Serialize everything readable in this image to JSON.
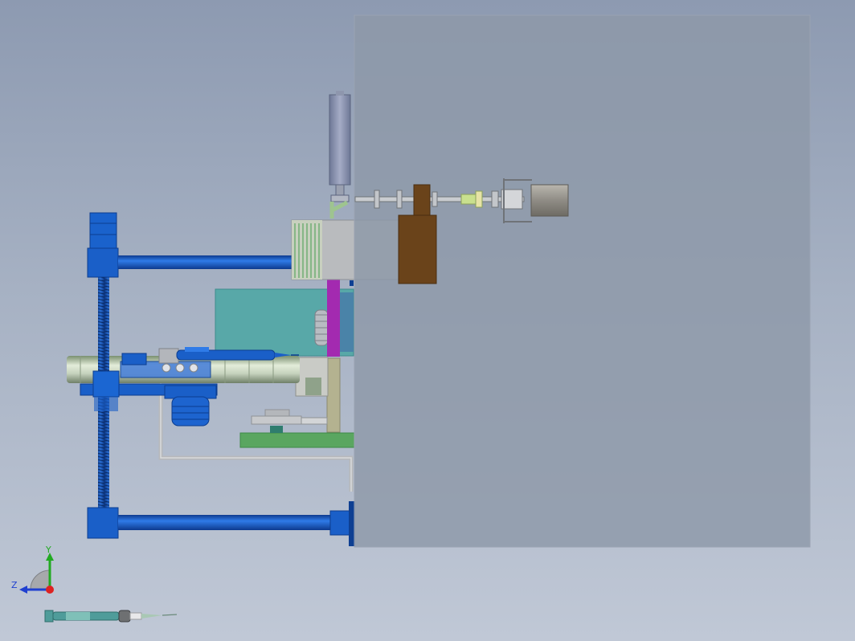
{
  "viewport": {
    "view_orientation": "Right",
    "background_gradient": [
      "#8d9ab1",
      "#c0c8d6"
    ]
  },
  "axis_triad": {
    "y_label": "Y",
    "z_label": "Z",
    "y_color": "#22aa22",
    "z_color": "#2040d0",
    "x_color": "#dd2222"
  },
  "model": {
    "components": [
      "translucent-housing",
      "top-motor-cylinder",
      "stepper-motor",
      "lead-screw-shaft",
      "brown-clamp-block",
      "grey-bearing-block",
      "vertical-screw-column",
      "upper-support-arm",
      "lower-support-arm",
      "teal-mount-plate",
      "magenta-guide-rail",
      "horizontal-shaft",
      "syringe-on-carriage",
      "gear-motor",
      "green-base-plate",
      "grey-frame-rod"
    ],
    "colors": {
      "blue": "#1a5fc8",
      "dark_blue": "#0e3f92",
      "brown": "#6a431a",
      "teal": "#58a8a8",
      "magenta": "#a32ab0",
      "green": "#5aa660",
      "housing": "#8e98a8"
    }
  }
}
